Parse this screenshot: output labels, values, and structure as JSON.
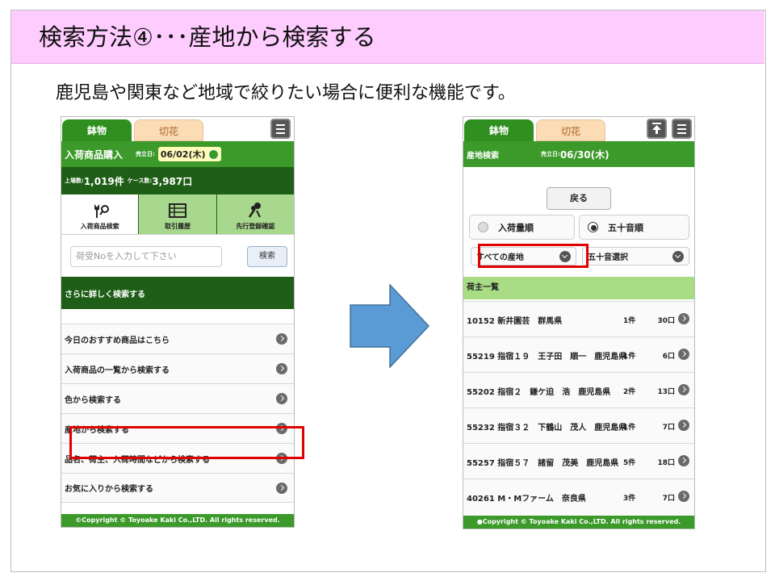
{
  "slide": {
    "title": "検索方法④･･･産地から検索する",
    "subtitle": "鹿児島や関東など地域で絞りたい場合に便利な機能です。"
  },
  "left_phone": {
    "tabs": [
      "鉢物",
      "切花"
    ],
    "header_title": "入荷商品購入",
    "date_label": "売立日:",
    "date_value": "06/02(木)",
    "stats": {
      "listing_label": "上場数:",
      "listing_value": "1,019件",
      "case_label": "ケース数:",
      "case_value": "3,987口"
    },
    "icon_tabs": [
      "入荷商品検索",
      "取引履歴",
      "先行登録確認"
    ],
    "search_placeholder": "荷受Noを入力して下さい",
    "search_button": "検索",
    "advanced": "さらに詳しく検索する",
    "menu": [
      "今日のおすすめ商品はこちら",
      "入荷商品の一覧から検索する",
      "色から検索する",
      "産地から検索する",
      "品名、荷主、入荷時間などから検索する",
      "お気に入りから検索する"
    ],
    "footer": "©Copyright © Toyoake Kaki Co.,LTD. All rights reserved."
  },
  "right_phone": {
    "tabs": [
      "鉢物",
      "切花"
    ],
    "header_title": "産地検索",
    "date_label": "売立日:",
    "date_value": "06/30(木)",
    "back_button": "戻る",
    "sort_options": [
      "入荷量順",
      "五十音順"
    ],
    "selected_sort": "五十音順",
    "region_select": "すべての産地",
    "kana_select": "五十音選択",
    "list_header": "荷主一覧",
    "shippers": [
      {
        "name": "10152 新井園芸　群馬県",
        "count": "1件",
        "cases": "30口"
      },
      {
        "name": "55219 指宿１９　王子田　順一　鹿児島県",
        "count": "1件",
        "cases": "6口"
      },
      {
        "name": "55202 指宿２　鎌ケ迫　浩　鹿児島県",
        "count": "2件",
        "cases": "13口"
      },
      {
        "name": "55232 指宿３２　下鶴山　茂人　鹿児島県",
        "count": "1件",
        "cases": "7口"
      },
      {
        "name": "55257 指宿５７　諸留　茂美　鹿児島県",
        "count": "5件",
        "cases": "18口"
      },
      {
        "name": "40261 M・Mファーム　奈良県",
        "count": "3件",
        "cases": "7口"
      }
    ],
    "footer": "●Copyright © Toyoake Kaki Co.,LTD. All rights reserved."
  },
  "colors": {
    "green": "#3b9a2a",
    "dark_green": "#1f5e16",
    "highlight": "#e00000",
    "title_bg": "#ffccff",
    "arrow": "#5b9bd5"
  }
}
